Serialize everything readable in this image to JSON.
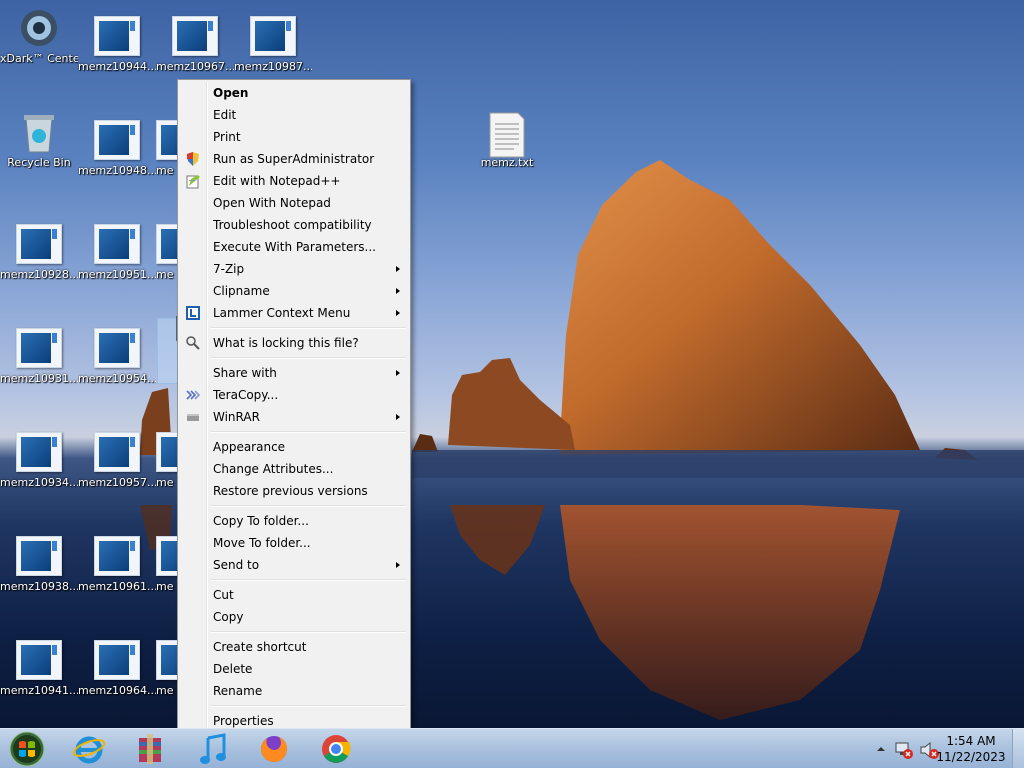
{
  "desktop": {
    "icons": [
      {
        "label": "xDark™ Center"
      },
      {
        "label": "Recycle Bin"
      },
      {
        "label": "memz10944..."
      },
      {
        "label": "memz10967..."
      },
      {
        "label": "memz10987..."
      },
      {
        "label": "memz10948..."
      },
      {
        "label": "memz10928..."
      },
      {
        "label": "memz10951..."
      },
      {
        "label": "memz10931..."
      },
      {
        "label": "memz10954..."
      },
      {
        "label": "memz10934..."
      },
      {
        "label": "memz10957..."
      },
      {
        "label": "memz10938..."
      },
      {
        "label": "memz10961..."
      },
      {
        "label": "memz10941..."
      },
      {
        "label": "memz10964..."
      },
      {
        "label": "me"
      },
      {
        "label": "me"
      },
      {
        "label": "me"
      },
      {
        "label": "me"
      },
      {
        "label": "me"
      },
      {
        "label": "memz.txt"
      }
    ]
  },
  "context_menu": {
    "items": [
      {
        "label": "Open",
        "bold": true
      },
      {
        "label": "Edit"
      },
      {
        "label": "Print"
      },
      {
        "label": "Run as SuperAdministrator",
        "icon": "shield-icon"
      },
      {
        "label": "Edit with Notepad++",
        "icon": "notepad-plus-plus-icon"
      },
      {
        "label": "Open With Notepad"
      },
      {
        "label": "Troubleshoot compatibility"
      },
      {
        "label": "Execute With Parameters..."
      },
      {
        "label": "7-Zip",
        "submenu": true
      },
      {
        "label": "Clipname",
        "submenu": true
      },
      {
        "label": "Lammer Context Menu",
        "submenu": true,
        "icon": "lammer-icon"
      },
      {
        "label": "What is locking this file?",
        "icon": "magnifier-lock-icon"
      },
      {
        "label": "Share with",
        "submenu": true
      },
      {
        "label": "TeraCopy...",
        "icon": "teracopy-icon"
      },
      {
        "label": "WinRAR",
        "submenu": true,
        "icon": "winrar-icon"
      },
      {
        "label": "Appearance"
      },
      {
        "label": "Change Attributes..."
      },
      {
        "label": "Restore previous versions"
      },
      {
        "label": "Copy To folder..."
      },
      {
        "label": "Move To folder..."
      },
      {
        "label": "Send to",
        "submenu": true
      },
      {
        "label": "Cut"
      },
      {
        "label": "Copy"
      },
      {
        "label": "Create shortcut"
      },
      {
        "label": "Delete"
      },
      {
        "label": "Rename"
      },
      {
        "label": "Properties"
      }
    ]
  },
  "taskbar": {
    "pinned": [
      "internet-explorer-icon",
      "winrar-archive-icon",
      "media-player-icon",
      "firefox-icon",
      "chrome-icon"
    ],
    "clock": {
      "time": "1:54 AM",
      "date": "11/22/2023"
    }
  },
  "colors": {
    "menu_bg": "#f1f1f1",
    "menu_border": "#979797",
    "taskbar_top": "#c5d6ea",
    "taskbar_bottom": "#96b2d6"
  }
}
